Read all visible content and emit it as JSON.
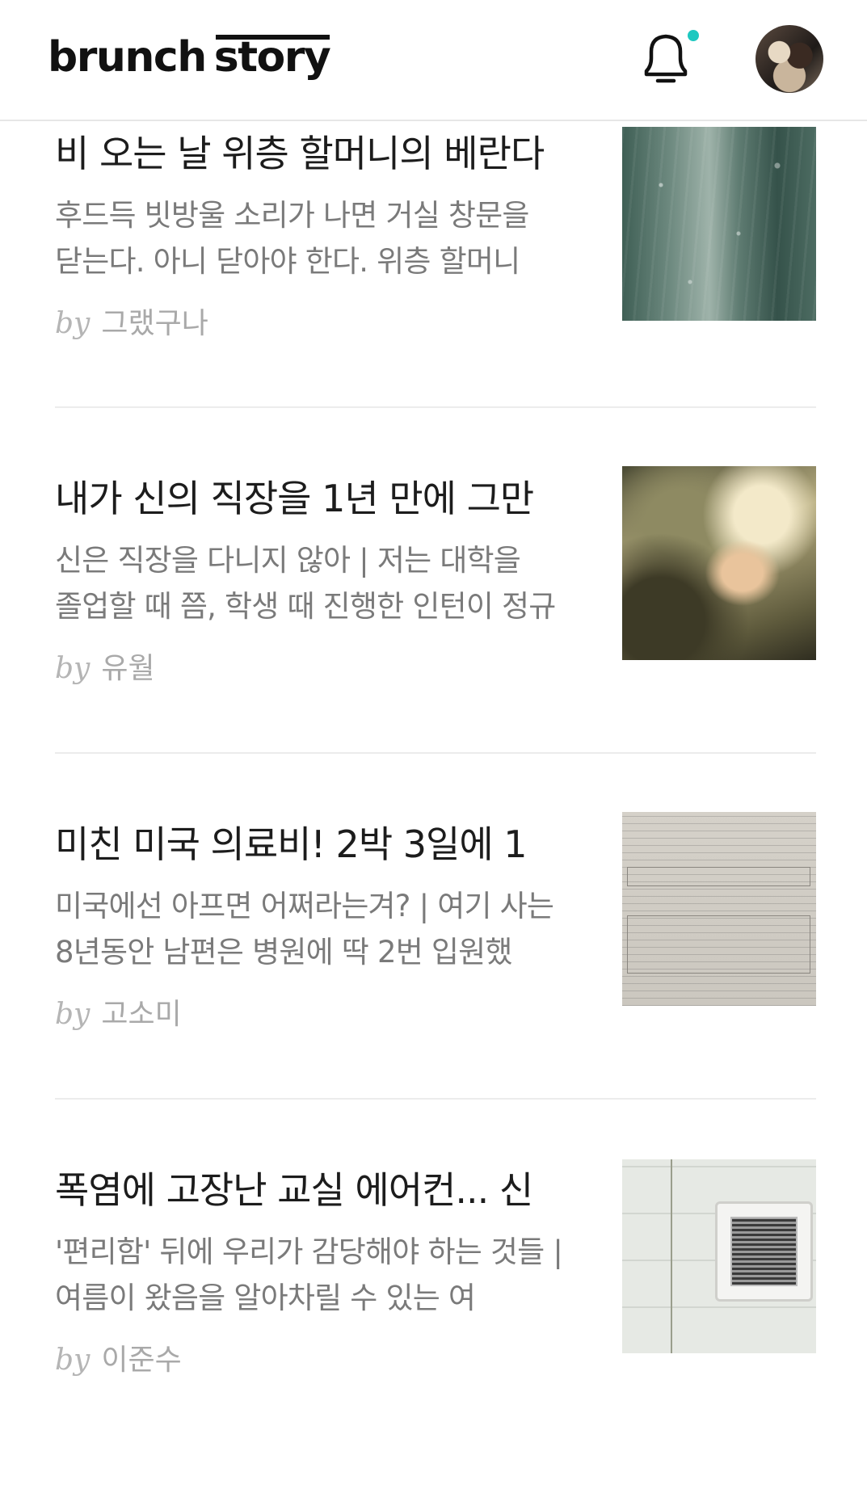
{
  "header": {
    "logo_part1": "brunch",
    "logo_part2": "story",
    "notification_icon": "bell-icon",
    "notification_dot_color": "#1ec8c0",
    "avatar_icon": "profile-avatar"
  },
  "articles": [
    {
      "title": "비 오는 날 위층 할머니의 베란다",
      "description": "후드득 빗방울 소리가 나면 거실 창문을 닫는다. 아니 닫아야 한다.   위층 할머니",
      "by": "by",
      "author": "그랬구나",
      "thumbnail": "rainy-window-image"
    },
    {
      "title": "내가 신의 직장을 1년 만에 그만",
      "description": "신은 직장을 다니지 않아 | 저는 대학을 졸업할 때 쯤, 학생 때 진행한 인턴이 정규",
      "by": "by",
      "author": "유월",
      "thumbnail": "hand-in-clouds-image"
    },
    {
      "title": "미친 미국 의료비! 2박 3일에 1",
      "description": "미국에선 아프면 어쩌라는겨? | 여기 사는 8년동안 남편은 병원에 딱 2번 입원했",
      "by": "by",
      "author": "고소미",
      "thumbnail": "medical-bill-document-image"
    },
    {
      "title": "폭염에 고장난 교실 에어컨... 신",
      "description": "'편리함' 뒤에 우리가 감당해야 하는 것들 | 여름이 왔음을 알아차릴 수 있는 여",
      "by": "by",
      "author": "이준수",
      "thumbnail": "ceiling-air-conditioner-image"
    }
  ]
}
